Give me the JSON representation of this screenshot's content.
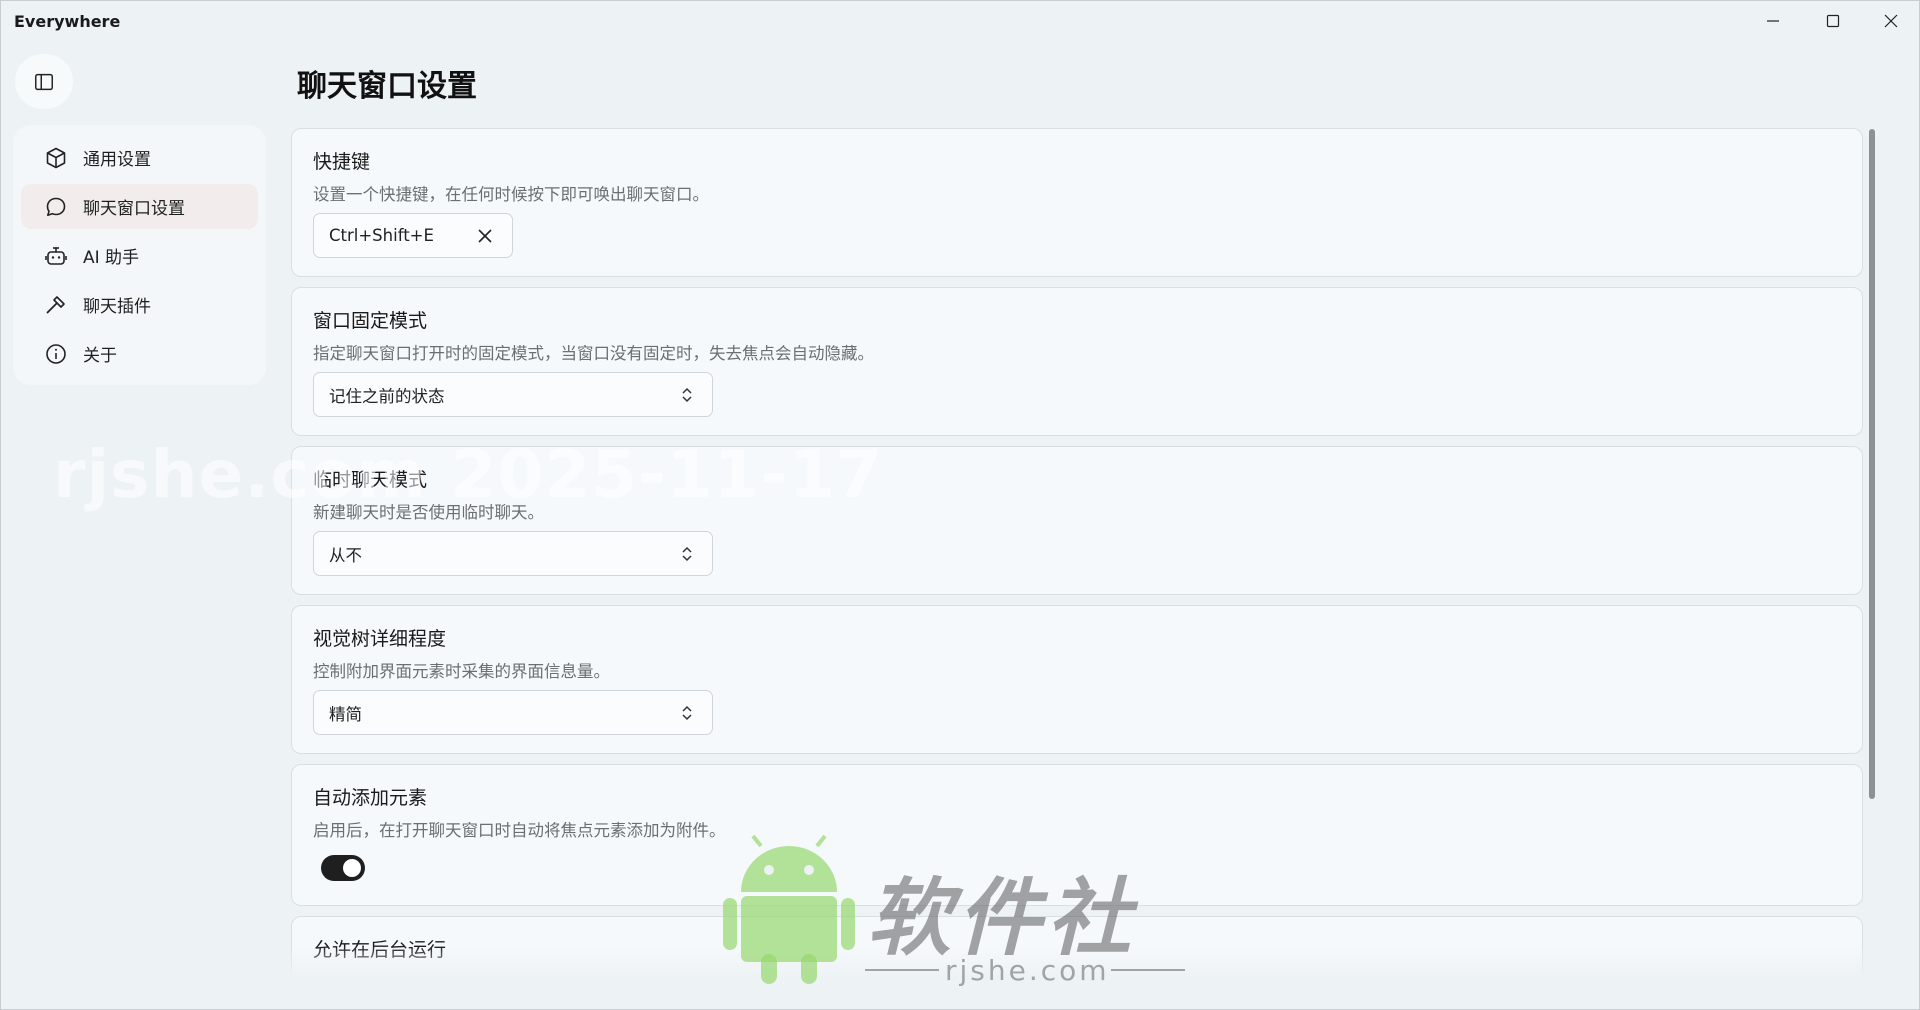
{
  "app": {
    "title": "Everywhere"
  },
  "window_controls": {
    "minimize": "minimize-icon",
    "maximize": "maximize-icon",
    "close": "close-icon"
  },
  "sidebar": {
    "toggle_icon": "sidebar-panel-icon",
    "items": [
      {
        "label": "通用设置",
        "icon": "cube-icon",
        "active": false
      },
      {
        "label": "聊天窗口设置",
        "icon": "chat-bubble-icon",
        "active": true
      },
      {
        "label": "AI 助手",
        "icon": "robot-icon",
        "active": false
      },
      {
        "label": "聊天插件",
        "icon": "hammer-icon",
        "active": false
      },
      {
        "label": "关于",
        "icon": "info-icon",
        "active": false
      }
    ]
  },
  "page": {
    "title": "聊天窗口设置"
  },
  "settings": {
    "hotkey": {
      "title": "快捷键",
      "description": "设置一个快捷键，在任何时候按下即可唤出聊天窗口。",
      "value": "Ctrl+Shift+E"
    },
    "pin_mode": {
      "title": "窗口固定模式",
      "description": "指定聊天窗口打开时的固定模式，当窗口没有固定时，失去焦点会自动隐藏。",
      "value": "记住之前的状态"
    },
    "temp_chat": {
      "title": "临时聊天模式",
      "description": "新建聊天时是否使用临时聊天。",
      "value": "从不"
    },
    "visual_tree": {
      "title": "视觉树详细程度",
      "description": "控制附加界面元素时采集的界面信息量。",
      "value": "精简"
    },
    "auto_add": {
      "title": "自动添加元素",
      "description": "启用后，在打开聊天窗口时自动将焦点元素添加为附件。",
      "enabled": true
    },
    "background": {
      "title": "允许在后台运行"
    }
  },
  "watermark": {
    "date": "rjshe.com 2025-11-17",
    "brand": "软件社",
    "domain": "rjshe.com"
  },
  "colors": {
    "accent": "#1f1f1f",
    "active_nav": "#f2ecec",
    "background": "#edf2f5"
  }
}
